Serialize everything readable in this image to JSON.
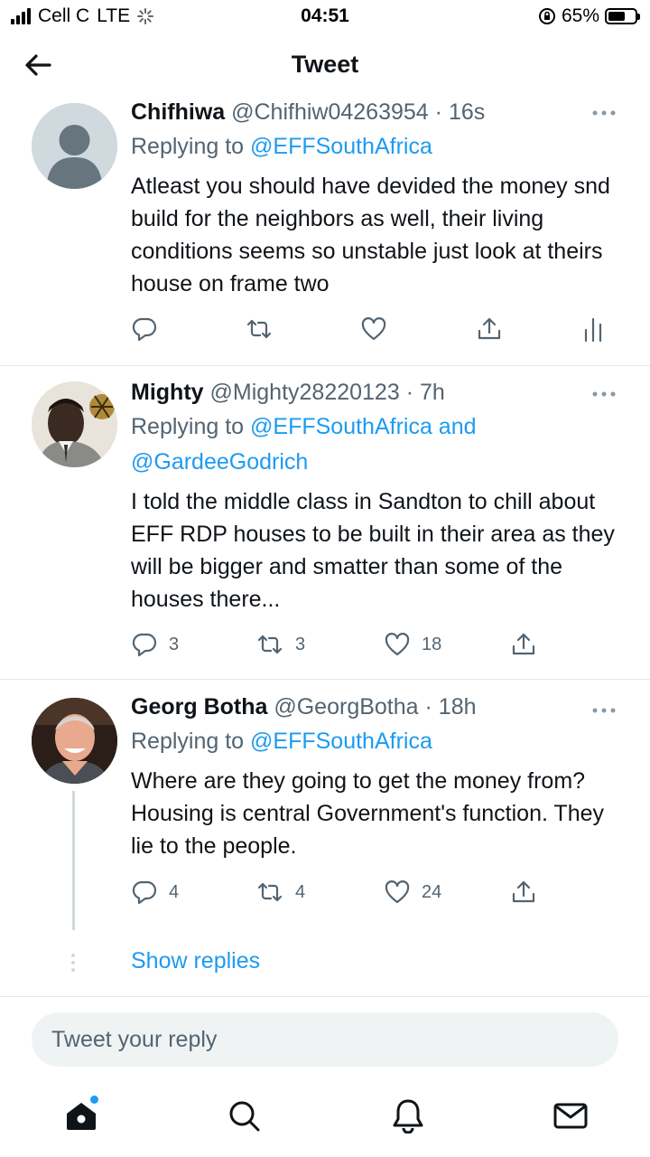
{
  "status_bar": {
    "carrier": "Cell C",
    "network": "LTE",
    "time": "04:51",
    "battery": "65%",
    "battery_level": 0.65
  },
  "header": {
    "title": "Tweet",
    "back_icon": "arrow-left-icon"
  },
  "tweets": [
    {
      "name": "Chifhiwa",
      "handle": "@Chifhiw04263954",
      "time": "· 16s",
      "replying_prefix": "Replying to",
      "replying_to": "@EFFSouthAfrica",
      "text": "Atleast you should have devided the money snd build for the neighbors as well, their living conditions seems so unstable just look at theirs house on frame two",
      "replies": "",
      "retweets": "",
      "likes": ""
    },
    {
      "name": "Mighty",
      "handle": "@Mighty28220123",
      "time": "· 7h",
      "replying_prefix": "Replying to",
      "replying_to": "@EFFSouthAfrica and @GardeeGodrich",
      "text": "I told the middle class in Sandton to chill about EFF RDP houses to be built in their area as they will be bigger and smatter than some of the houses there...",
      "replies": "3",
      "retweets": "3",
      "likes": "18"
    },
    {
      "name": "Georg Botha",
      "handle": "@GeorgBotha",
      "time": "· 18h",
      "replying_prefix": "Replying to",
      "replying_to": "@EFFSouthAfrica",
      "text": "Where are they going to get the money from? Housing is central Government's function. They lie to the people.",
      "replies": "4",
      "retweets": "4",
      "likes": "24"
    }
  ],
  "show_replies": "Show replies",
  "reply_input": {
    "placeholder": "Tweet your reply"
  },
  "bottom_nav": {
    "items": [
      "home-icon",
      "search-icon",
      "notifications-icon",
      "messages-icon"
    ]
  },
  "colors": {
    "accent": "#1d9bf0",
    "secondary_text": "#536471",
    "divider": "#e1e8ed"
  }
}
